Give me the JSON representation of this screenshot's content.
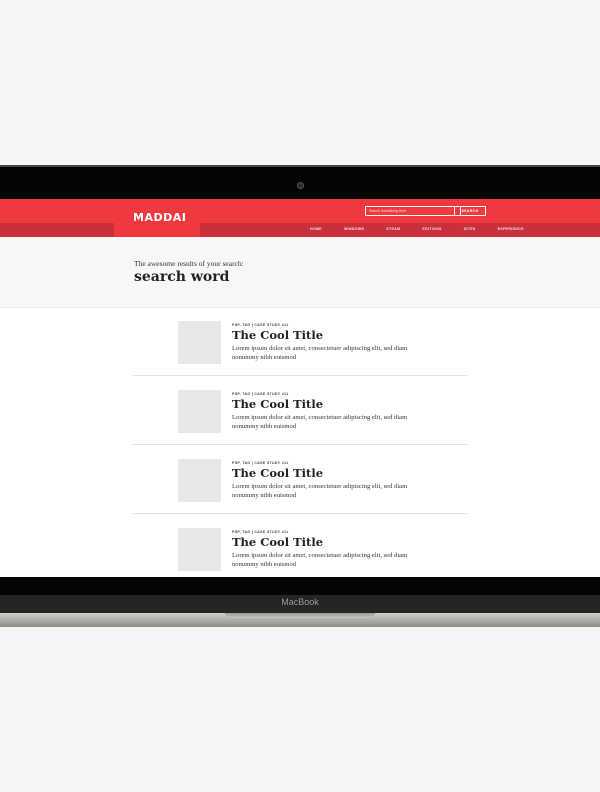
{
  "site": {
    "logo": "MADDAI",
    "search": {
      "placeholder": "Search Something Here",
      "button_label": "SEARCH"
    },
    "nav": [
      "HOME",
      "WINDOWS",
      "STEAM",
      "EDITIONS",
      "SITES",
      "EXPERIENCE"
    ]
  },
  "results": {
    "kicker": "The awesome results of your search:",
    "query": "search word",
    "items": [
      {
        "tag": "PSP, TAG | CASE STUDY #11",
        "title": "The Cool Title",
        "excerpt": "Lorem ipsum dolor sit amet, consectetuer adipiscing elit, sed diam nonummy nibh euismod"
      },
      {
        "tag": "PSP, TAG | CASE STUDY #11",
        "title": "The Cool Title",
        "excerpt": "Lorem ipsum dolor sit amet, consectetuer adipiscing elit, sed diam nonummy nibh euismod"
      },
      {
        "tag": "PSP, TAG | CASE STUDY #11",
        "title": "The Cool Title",
        "excerpt": "Lorem ipsum dolor sit amet, consectetuer adipiscing elit, sed diam nonummy nibh euismod"
      },
      {
        "tag": "PSP, TAG | CASE STUDY #11",
        "title": "The Cool Title",
        "excerpt": "Lorem ipsum dolor sit amet, consectetuer adipiscing elit, sed diam nonummy nibh euismod"
      }
    ]
  },
  "device": {
    "brand": "MacBook"
  },
  "colors": {
    "accent": "#f0393f",
    "accent_dark": "#c9303a"
  }
}
